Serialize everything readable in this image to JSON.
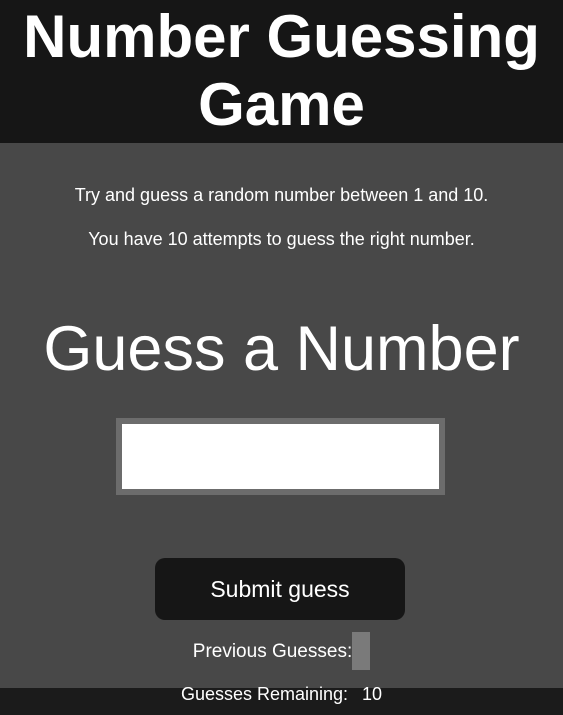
{
  "header": {
    "title_line1": "Number Guessing",
    "title_line2": "Game"
  },
  "intro": {
    "line1": "Try and guess a random number between 1 and 10.",
    "line2": "You have 10 attempts to guess the right number."
  },
  "form": {
    "heading": "Guess a Number",
    "input_value": "",
    "submit_label": "Submit guess"
  },
  "status": {
    "previous_label": "Previous Guesses:",
    "previous_guesses": "",
    "remaining_label": "Guesses Remaining:",
    "remaining_value": "10"
  },
  "colors": {
    "header_bg": "#161616",
    "panel_bg": "#484848",
    "button_bg": "#161616",
    "input_border": "#6c6c6c",
    "previous_box": "#7a7a7a"
  }
}
